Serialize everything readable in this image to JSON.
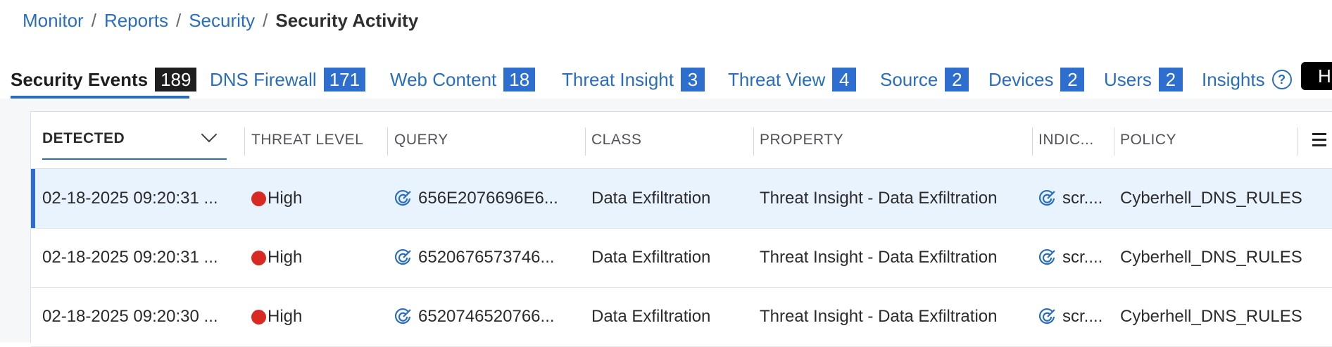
{
  "breadcrumb": {
    "items": [
      "Monitor",
      "Reports",
      "Security"
    ],
    "separator": "/",
    "current": "Security Activity"
  },
  "tabs": [
    {
      "label": "Security Events",
      "count": "189",
      "active": true
    },
    {
      "label": "DNS Firewall",
      "count": "171"
    },
    {
      "label": "Web Content",
      "count": "18"
    },
    {
      "label": "Threat Insight",
      "count": "3"
    },
    {
      "label": "Threat View",
      "count": "4"
    },
    {
      "label": "Source",
      "count": "2"
    },
    {
      "label": "Devices",
      "count": "2"
    },
    {
      "label": "Users",
      "count": "2"
    },
    {
      "label": "Insights",
      "help_icon": "?"
    }
  ],
  "tab_overflow_label": "H",
  "table": {
    "columns": [
      "DETECTED",
      "THREAT LEVEL",
      "QUERY",
      "CLASS",
      "PROPERTY",
      "INDIC...",
      "POLICY"
    ],
    "rows": [
      {
        "detected": "02-18-2025 09:20:31 ...",
        "threat_level": "High",
        "query": "656E2076696E6...",
        "class": "Data Exfiltration",
        "property": "Threat Insight - Data Exfiltration",
        "indicator": "scr....",
        "policy": "Cyberhell_DNS_RULES",
        "selected": true
      },
      {
        "detected": "02-18-2025 09:20:31 ...",
        "threat_level": "High",
        "query": "6520676573746...",
        "class": "Data Exfiltration",
        "property": "Threat Insight - Data Exfiltration",
        "indicator": "scr....",
        "policy": "Cyberhell_DNS_RULES"
      },
      {
        "detected": "02-18-2025 09:20:30 ...",
        "threat_level": "High",
        "query": "6520746520766...",
        "class": "Data Exfiltration",
        "property": "Threat Insight - Data Exfiltration",
        "indicator": "scr....",
        "policy": "Cyberhell_DNS_RULES"
      }
    ]
  },
  "colors": {
    "link": "#2a6ebb",
    "badge": "#2d6ecf",
    "active_badge": "#1e1e1e",
    "threat_high": "#d62a22",
    "selected_row": "#e8f3fd"
  },
  "icons": {
    "sort": "chevron-down-icon",
    "column_menu": "hamburger-menu-icon",
    "query_indicator": "target-icon",
    "help": "help-circle-icon"
  }
}
